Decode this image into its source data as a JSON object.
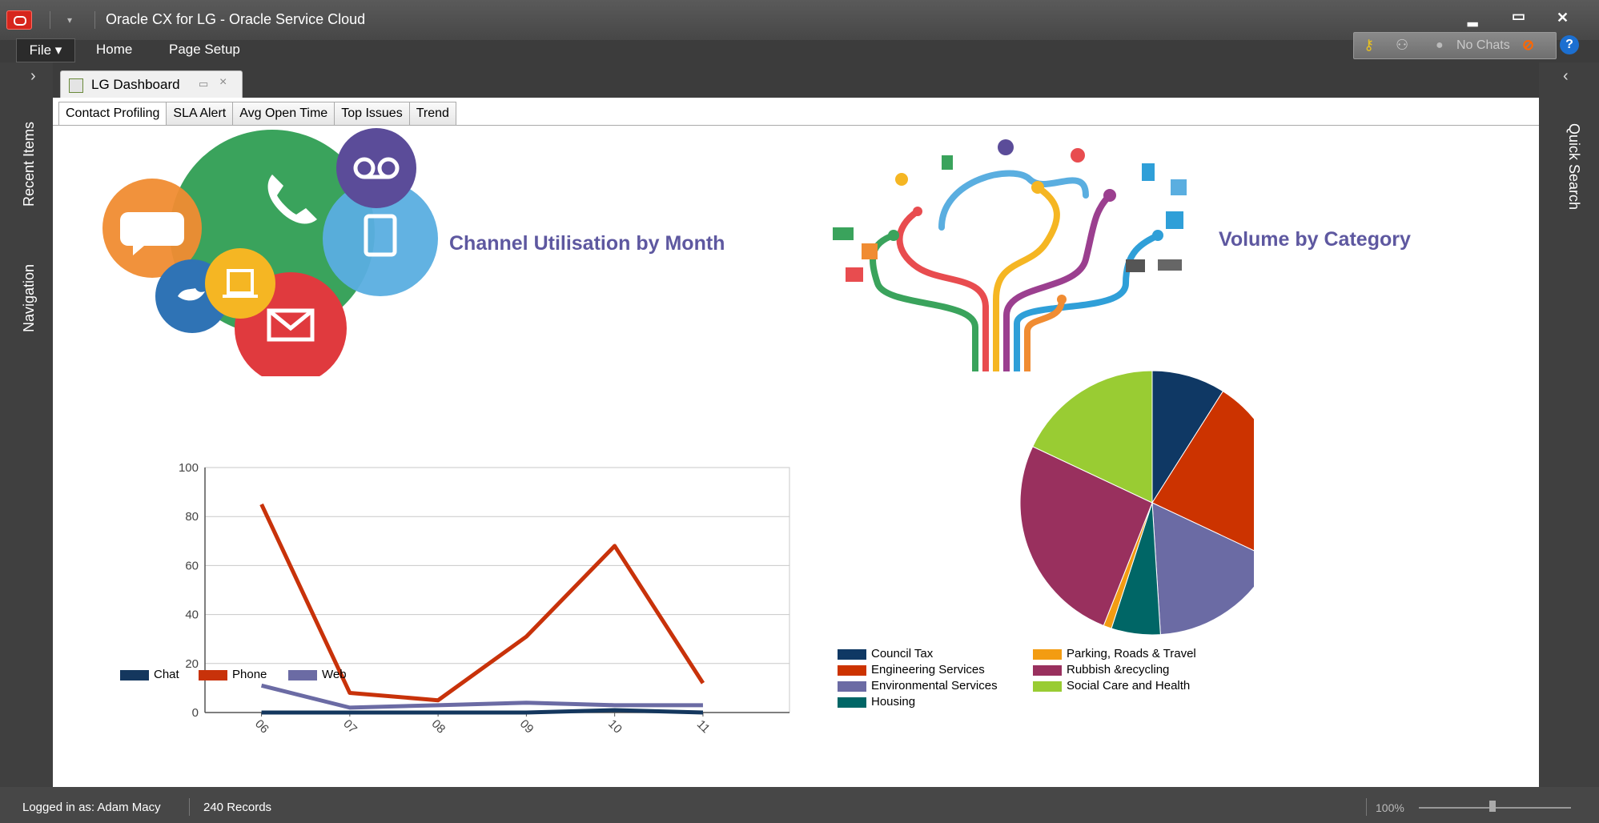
{
  "window": {
    "title": "Oracle CX for LG  -  Oracle Service Cloud",
    "controls": {
      "minimize": "▂",
      "maximize": "▭",
      "close": "✕"
    }
  },
  "menu": {
    "file_label": "File ▾",
    "home_label": "Home",
    "page_setup_label": "Page Setup"
  },
  "toolbar_right": {
    "no_chats_label": "No Chats",
    "help_label": "?"
  },
  "sidebar_left": {
    "expand_icon": "›",
    "recent_items_label": "Recent Items",
    "navigation_label": "Navigation"
  },
  "sidebar_right": {
    "collapse_icon": "‹",
    "quick_search_label": "Quick Search"
  },
  "document_tab": {
    "label": "LG Dashboard",
    "close": "×"
  },
  "subtabs": [
    "Contact Profiling",
    "SLA Alert",
    "Avg Open Time",
    "Top Issues",
    "Trend"
  ],
  "charts": {
    "line_title": "Channel Utilisation by Month",
    "pie_title": "Volume by Category"
  },
  "chart_data": [
    {
      "type": "line",
      "title": "Channel Utilisation by Month",
      "x": [
        "06",
        "07",
        "08",
        "09",
        "10",
        "11"
      ],
      "ylim": [
        0,
        100
      ],
      "yticks": [
        0,
        20,
        40,
        60,
        80,
        100
      ],
      "grid": true,
      "legend": "bottom-left",
      "series": [
        {
          "name": "Chat",
          "color": "#14375e",
          "values": [
            0,
            0,
            0,
            0,
            1,
            0
          ]
        },
        {
          "name": "Phone",
          "color": "#c8320a",
          "values": [
            85,
            8,
            5,
            31,
            68,
            12
          ]
        },
        {
          "name": "Web",
          "color": "#6b6ba4",
          "values": [
            11,
            2,
            3,
            4,
            3,
            3
          ]
        }
      ]
    },
    {
      "type": "pie",
      "title": "Volume by Category",
      "legend": "bottom",
      "slices": [
        {
          "name": "Council Tax",
          "color": "#0f3864",
          "value": 9
        },
        {
          "name": "Engineering Services",
          "color": "#cc3300",
          "value": 23
        },
        {
          "name": "Environmental Services",
          "color": "#6b6ba4",
          "value": 17
        },
        {
          "name": "Housing",
          "color": "#006666",
          "value": 6
        },
        {
          "name": "Parking, Roads & Travel",
          "color": "#f39c12",
          "value": 1
        },
        {
          "name": "Rubbish &recycling",
          "color": "#99305e",
          "value": 26
        },
        {
          "name": "Social Care and Health",
          "color": "#99cc33",
          "value": 18
        }
      ]
    }
  ],
  "status": {
    "logged_in": "Logged in as: Adam Macy",
    "records": "240 Records",
    "zoom": "100%"
  }
}
